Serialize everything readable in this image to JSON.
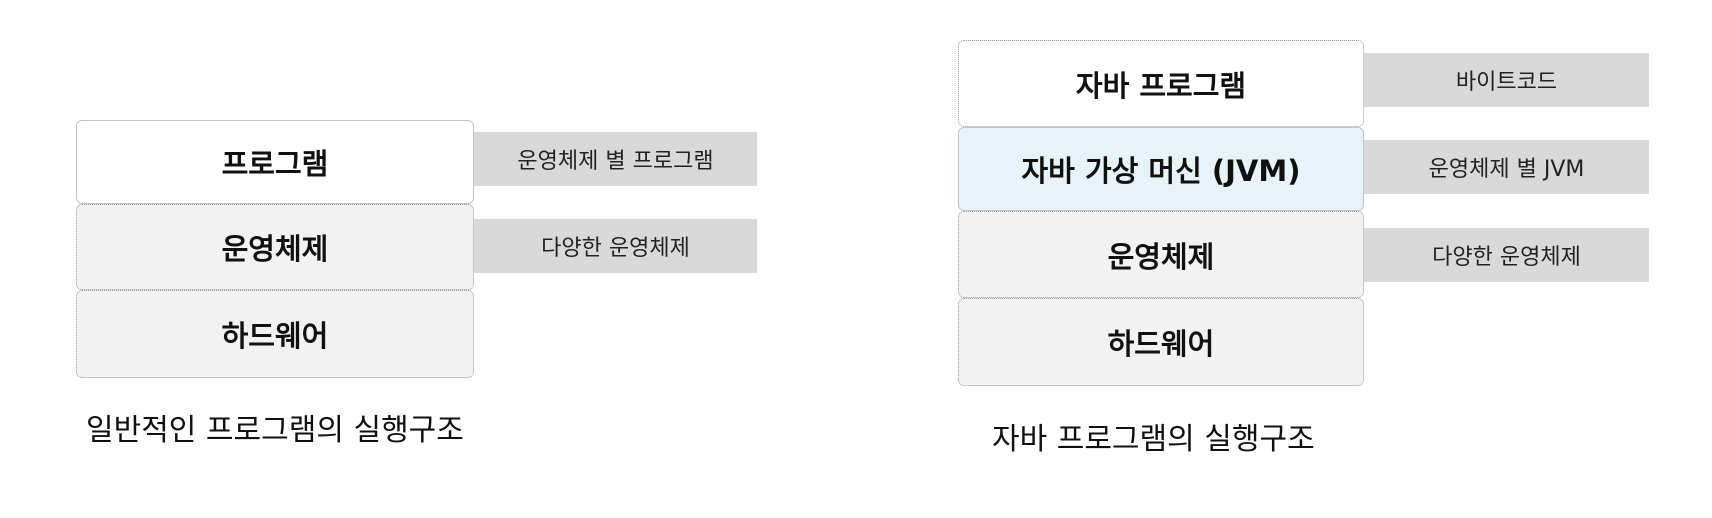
{
  "left_diagram": {
    "layers": {
      "program": "프로그램",
      "os": "운영체제",
      "hardware": "하드웨어"
    },
    "tags": {
      "program": "운영체제 별 프로그램",
      "os": "다양한 운영체제"
    },
    "caption": "일반적인 프로그램의 실행구조"
  },
  "right_diagram": {
    "layers": {
      "java_program": "자바 프로그램",
      "jvm": "자바 가상 머신 (JVM)",
      "os": "운영체제",
      "hardware": "하드웨어"
    },
    "tags": {
      "java_program": "바이트코드",
      "jvm": "운영체제 별 JVM",
      "os": "다양한 운영체제"
    },
    "caption": "자바 프로그램의 실행구조"
  },
  "colors": {
    "layer_gray": "#f2f2f2",
    "layer_white": "#ffffff",
    "layer_jvm": "#e8f2f9",
    "tag_gray": "#d9d9d9"
  }
}
